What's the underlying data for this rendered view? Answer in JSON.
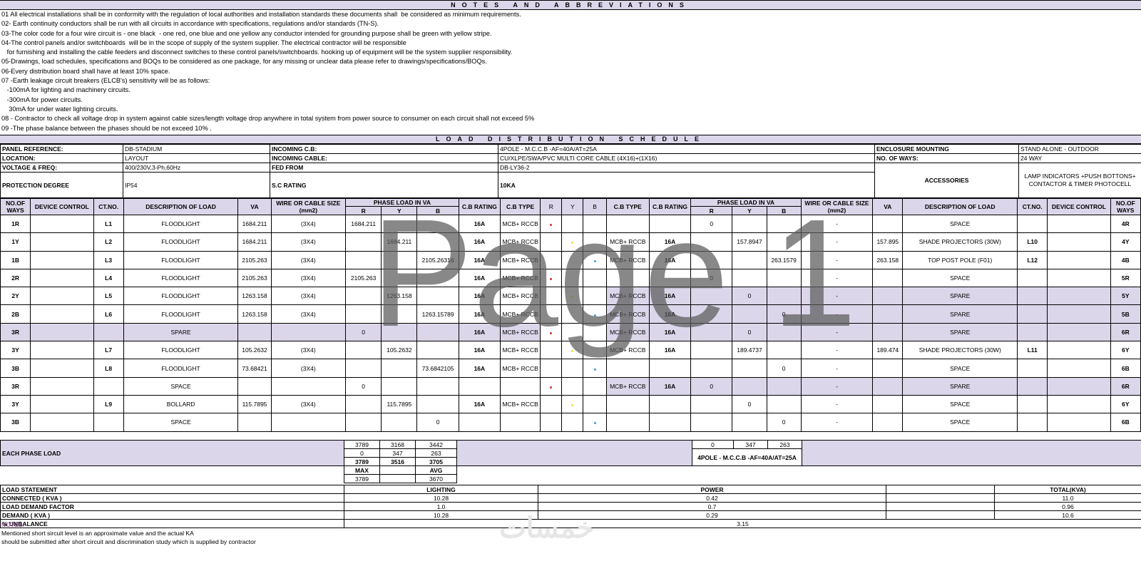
{
  "notes_title": "NOTES   AND   ABBREVIATIONS",
  "notes": [
    "01 All electrical installations shall be in conformity with the regulation of local authorities and installation standards these documents shall  be considered as minimum requirements.",
    "02- Earth continuity conductors shall be run with all circuits in accordance with specifications, regulations and/or standards (TN-S).",
    "03-The color code for a four wire circuit is - one black  - one red, one blue and one yellow any conductor intended for grounding purpose shall be green with yellow stripe.",
    "04-The control panels and/or switchboards  will be in the scope of supply of the system supplier. The electrical contractor will be responsible",
    "   for furnishing and installing the cable feeders and disconnect switches to these control panels/switchboards. hooking up of equipment will be the system supplier responsibility.",
    "05-Drawings, load schedules, specifications and BOQs to be considered as one package, for any missing or unclear data please refer to drawings/specifications/BOQs.",
    "06-Every distribution board shall have at least 10% space.",
    "07 -Earth leakage circuit breakers (ELCB's) sensitivity will be as follows:",
    "   -100mA for lighting and machinery circuits.",
    "   -300mA for power circuits.",
    "    30mA for under water lighting circuits.",
    "08 - Contractor to check all voltage drop in system against cable sizes/length voltage drop anywhere in total system from power source to consumer on each circuit shall not exceed 5%",
    "09 -The phase balance between the phases should be not exceed 10% ."
  ],
  "schedule_title": "LOAD   DISTRIBUTION   SCHEDULE",
  "panel": {
    "panel_ref_label": "PANEL REFERENCE:",
    "panel_ref": "DB-STADIUM",
    "location_label": "LOCATION:",
    "location": "LAYOUT",
    "voltage_label": "VOLTAGE & FREQ:",
    "voltage": "400/230V,3-Ph,60Hz",
    "protection_label": "PROTECTION DEGREE",
    "protection": "IP54",
    "incoming_cb_label": "INCOMING C.B:",
    "incoming_cb": "4POLE - M.C.C.B -AF=40A/AT=25A",
    "incoming_cable_label": "INCOMING CABLE:",
    "incoming_cable": "CU/XLPE/SWA/PVC MULTI CORE CABLE (4X16)+(1X16)",
    "fed_from_label": "FED FROM",
    "fed_from": "DB-LY36-2",
    "sc_label": "S.C RATING",
    "sc": "10KA",
    "enclosure_label": "ENCLOSURE MOUNTING",
    "enclosure": "STAND ALONE - OUTDOOR",
    "ways_label": "NO. OF WAYS:",
    "ways": "24 WAY",
    "accessories_label": "ACCESSORIES",
    "accessories": "LAMP INDICATORS +PUSH BOTTONS+ CONTACTOR & TIMER PHOTOCELL"
  },
  "headers": {
    "ways": "NO.OF WAYS",
    "device": "DEVICE CONTROL",
    "ct": "CT.NO.",
    "desc": "DESCRIPTION OF LOAD",
    "va": "VA",
    "wire": "WIRE OR CABLE SIZE (mm2)",
    "phase": "PHASE LOAD IN VA",
    "r": "R",
    "y": "Y",
    "b": "B",
    "cb_rating": "C.B RATING",
    "cb_type": "C.B TYPE"
  },
  "rows": [
    {
      "lway": "1R",
      "lct": "L1",
      "ldesc": "FLOODLIGHT",
      "lva": "1684.211",
      "lwire": "(3X4)",
      "lr": "1684.211",
      "ly": "",
      "lb": "",
      "lcbr": "16A",
      "lcbt": "MCB+ RCCB",
      "dot": "red",
      "rcbt": "",
      "rcbr": "",
      "rr": "0",
      "ry": "",
      "rb": "",
      "rwire": "-",
      "rva": "",
      "rdesc": "SPACE",
      "rct": "",
      "rway": "4R",
      "shade": false
    },
    {
      "lway": "1Y",
      "lct": "L2",
      "ldesc": "FLOODLIGHT",
      "lva": "1684.211",
      "lwire": "(3X4)",
      "lr": "",
      "ly": "1684.211",
      "lb": "",
      "lcbr": "16A",
      "lcbt": "MCB+ RCCB",
      "dot": "yellow",
      "rcbt": "MCB+ RCCB",
      "rcbr": "16A",
      "rr": "",
      "ry": "157.8947",
      "rb": "",
      "rwire": "-",
      "rva": "157.895",
      "rdesc": "SHADE PROJECTORS (30W)",
      "rct": "L10",
      "rway": "4Y",
      "shade": false
    },
    {
      "lway": "1B",
      "lct": "L3",
      "ldesc": "FLOODLIGHT",
      "lva": "2105.263",
      "lwire": "(3X4)",
      "lr": "",
      "ly": "",
      "lb": "2105.26316",
      "lcbr": "16A",
      "lcbt": "MCB+ RCCB",
      "dot": "blue",
      "rcbt": "MCB+ RCCB",
      "rcbr": "16A",
      "rr": "",
      "ry": "",
      "rb": "263.1579",
      "rwire": "-",
      "rva": "263.158",
      "rdesc": "TOP POST POLE (F01)",
      "rct": "L12",
      "rway": "4B",
      "shade": false
    },
    {
      "lway": "2R",
      "lct": "L4",
      "ldesc": "FLOODLIGHT",
      "lva": "2105.263",
      "lwire": "(3X4)",
      "lr": "2105.263",
      "ly": "",
      "lb": "",
      "lcbr": "16A",
      "lcbt": "MCB+ RCCB",
      "dot": "red",
      "rcbt": "",
      "rcbr": "",
      "rr": "0",
      "ry": "",
      "rb": "",
      "rwire": "-",
      "rva": "",
      "rdesc": "SPACE",
      "rct": "",
      "rway": "5R",
      "shade": false
    },
    {
      "lway": "2Y",
      "lct": "L5",
      "ldesc": "FLOODLIGHT",
      "lva": "1263.158",
      "lwire": "(3X4)",
      "lr": "",
      "ly": "1263.158",
      "lb": "",
      "lcbr": "16A",
      "lcbt": "MCB+ RCCB",
      "dot": "yellow",
      "rcbt": "MCB+ RCCB",
      "rcbr": "16A",
      "rr": "",
      "ry": "0",
      "rb": "",
      "rwire": "-",
      "rva": "",
      "rdesc": "SPARE",
      "rct": "",
      "rway": "5Y",
      "shade": true
    },
    {
      "lway": "2B",
      "lct": "L6",
      "ldesc": "FLOODLIGHT",
      "lva": "1263.158",
      "lwire": "(3X4)",
      "lr": "",
      "ly": "",
      "lb": "1263.15789",
      "lcbr": "16A",
      "lcbt": "MCB+ RCCB",
      "dot": "blue",
      "rcbt": "MCB+ RCCB",
      "rcbr": "16A",
      "rr": "",
      "ry": "",
      "rb": "0",
      "rwire": "-",
      "rva": "",
      "rdesc": "SPARE",
      "rct": "",
      "rway": "5B",
      "shade": true
    },
    {
      "lway": "3R",
      "lct": "",
      "ldesc": "SPARE",
      "lva": "",
      "lwire": "",
      "lr": "0",
      "ly": "",
      "lb": "",
      "lcbr": "16A",
      "lcbt": "MCB+ RCCB",
      "dot": "red",
      "rcbt": "MCB+ RCCB",
      "rcbr": "16A",
      "rr": "",
      "ry": "0",
      "rb": "",
      "rwire": "-",
      "rva": "",
      "rdesc": "SPARE",
      "rct": "",
      "rway": "6R",
      "shade": true
    },
    {
      "lway": "3Y",
      "lct": "L7",
      "ldesc": "FLOODLIGHT",
      "lva": "105.2632",
      "lwire": "(3X4)",
      "lr": "",
      "ly": "105.2632",
      "lb": "",
      "lcbr": "16A",
      "lcbt": "MCB+ RCCB",
      "dot": "yellow",
      "rcbt": "MCB+ RCCB",
      "rcbr": "16A",
      "rr": "",
      "ry": "189.4737",
      "rb": "",
      "rwire": "-",
      "rva": "189.474",
      "rdesc": "SHADE PROJECTORS (30W)",
      "rct": "L11",
      "rway": "6Y",
      "shade": false
    },
    {
      "lway": "3B",
      "lct": "L8",
      "ldesc": "FLOODLIGHT",
      "lva": "73.68421",
      "lwire": "(3X4)",
      "lr": "",
      "ly": "",
      "lb": "73.6842105",
      "lcbr": "16A",
      "lcbt": "MCB+ RCCB",
      "dot": "blue",
      "rcbt": "",
      "rcbr": "",
      "rr": "",
      "ry": "",
      "rb": "0",
      "rwire": "-",
      "rva": "",
      "rdesc": "SPACE",
      "rct": "",
      "rway": "6B",
      "shade": false
    },
    {
      "lway": "3R",
      "lct": "",
      "ldesc": "SPACE",
      "lva": "",
      "lwire": "",
      "lr": "0",
      "ly": "",
      "lb": "",
      "lcbr": "",
      "lcbt": "",
      "dot": "red",
      "rcbt": "MCB+ RCCB",
      "rcbr": "16A",
      "rr": "0",
      "ry": "",
      "rb": "",
      "rwire": "-",
      "rva": "",
      "rdesc": "SPARE",
      "rct": "",
      "rway": "6R",
      "shade": true
    },
    {
      "lway": "3Y",
      "lct": "L9",
      "ldesc": "BOLLARD",
      "lva": "115.7895",
      "lwire": "(3X4)",
      "lr": "",
      "ly": "115.7895",
      "lb": "",
      "lcbr": "16A",
      "lcbt": "MCB+ RCCB",
      "dot": "yellow",
      "rcbt": "",
      "rcbr": "",
      "rr": "",
      "ry": "0",
      "rb": "",
      "rwire": "-",
      "rva": "",
      "rdesc": "SPACE",
      "rct": "",
      "rway": "6Y",
      "shade": false
    },
    {
      "lway": "3B",
      "lct": "",
      "ldesc": "SPACE",
      "lva": "",
      "lwire": "",
      "lr": "",
      "ly": "",
      "lb": "0",
      "lcbr": "",
      "lcbt": "",
      "dot": "blue",
      "rcbt": "",
      "rcbr": "",
      "rr": "",
      "ry": "",
      "rb": "0",
      "rwire": "-",
      "rva": "",
      "rdesc": "SPACE",
      "rct": "",
      "rway": "6B",
      "shade": false
    }
  ],
  "phase_summary": {
    "label": "EACH PHASE LOAD",
    "row1": [
      "3789",
      "3168",
      "3442"
    ],
    "row2": [
      "0",
      "347",
      "263"
    ],
    "row3": [
      "3789",
      "3516",
      "3705"
    ],
    "max_label": "MAX",
    "avg_label": "AVG",
    "max": "3789",
    "avg": "3670",
    "right_row": [
      "0",
      "347",
      "263"
    ],
    "breaker": "4POLE - M.C.C.B -AF=40A/AT=25A"
  },
  "load_statement": {
    "title": "LOAD STATEMENT",
    "lighting": "LIGHTING",
    "power": "POWER",
    "total": "TOTAL(KVA)",
    "rows": [
      {
        "label": "CONNECTED ( KVA )",
        "lighting": "10.28",
        "power": "0.42",
        "total": "11.0"
      },
      {
        "label": "LOAD DEMAND FACTOR",
        "lighting": "1.0",
        "power": "0.7",
        "total": "0.96"
      },
      {
        "label": "DEMAND ( KVA )",
        "lighting": "10.28",
        "power": "0.29",
        "total": "10.6"
      }
    ],
    "unbalance_label": "% UNBALANCE",
    "unbalance": "3.15"
  },
  "footer": {
    "title": "NOTES:",
    "line1": "Mentioned short sircuit level is an approximate value and the actual KA",
    "line2": "should be submitted after short circuit and discrimination study which is supplied by contractor"
  },
  "watermark": "Page 1",
  "logo_text": "خمسات",
  "colors": {
    "red": "#d32f2f",
    "yellow": "#f0e040",
    "blue": "#3aa0e0",
    "header_bg": "#dcd6ea"
  }
}
